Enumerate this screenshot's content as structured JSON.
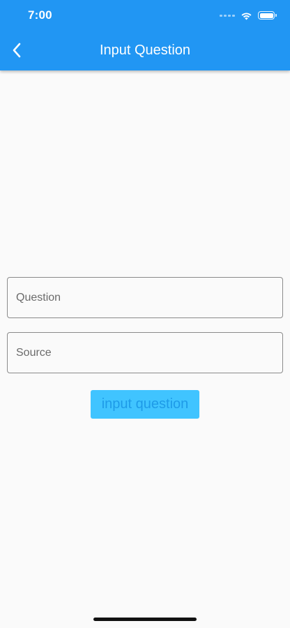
{
  "status_bar": {
    "time": "7:00",
    "battery_level": 1.0
  },
  "app_bar": {
    "title": "Input Question",
    "back_icon": "chevron-left-icon",
    "background_color": "#2196f3"
  },
  "form": {
    "question_placeholder": "Question",
    "question_value": "",
    "source_placeholder": "Source",
    "source_value": "",
    "submit_label": "input question",
    "submit_bg_color": "#40c4ff",
    "submit_text_color": "#1e9be8"
  }
}
